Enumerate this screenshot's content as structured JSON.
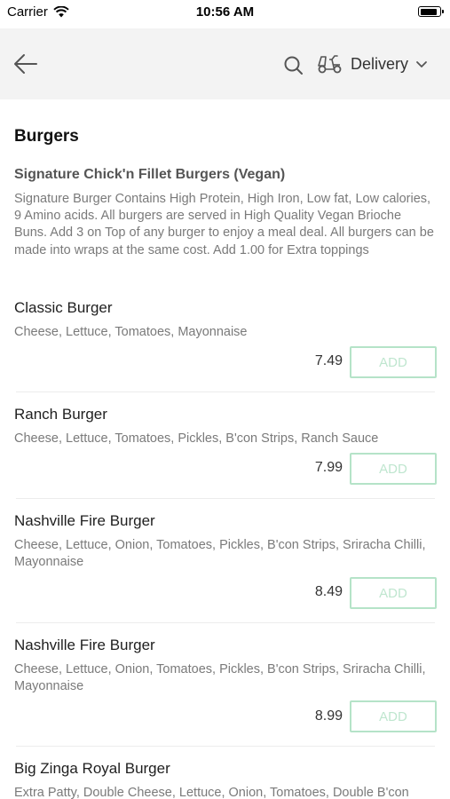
{
  "status_bar": {
    "carrier": "Carrier",
    "time": "10:56 AM",
    "battery_level": 0.9
  },
  "header": {
    "mode_label": "Delivery"
  },
  "menu": {
    "section_title": "Burgers",
    "category_title": "Signature Chick'n Fillet Burgers (Vegan)",
    "category_description": "Signature Burger Contains High Protein, High Iron, Low fat, Low calories, 9 Amino acids. All burgers are served in High Quality Vegan Brioche Buns. Add 3 on Top of any burger to enjoy a meal deal. All burgers can be made into wraps at the same cost. Add 1.00 for Extra toppings",
    "add_label": "ADD",
    "items": [
      {
        "name": "Classic Burger",
        "description": "Cheese, Lettuce, Tomatoes, Mayonnaise",
        "price": "7.49"
      },
      {
        "name": "Ranch Burger",
        "description": "Cheese, Lettuce, Tomatoes, Pickles, B'con Strips, Ranch Sauce",
        "price": "7.99"
      },
      {
        "name": "Nashville Fire Burger",
        "description": "Cheese, Lettuce, Onion, Tomatoes, Pickles, B'con Strips, Sriracha Chilli, Mayonnaise",
        "price": "8.49"
      },
      {
        "name": "Nashville Fire Burger",
        "description": "Cheese, Lettuce, Onion, Tomatoes, Pickles, B'con Strips, Sriracha Chilli, Mayonnaise",
        "price": "8.99"
      },
      {
        "name": "Big Zinga Royal Burger",
        "description": "Extra Patty, Double Cheese, Lettuce, Onion, Tomatoes, Double B'con"
      }
    ]
  }
}
